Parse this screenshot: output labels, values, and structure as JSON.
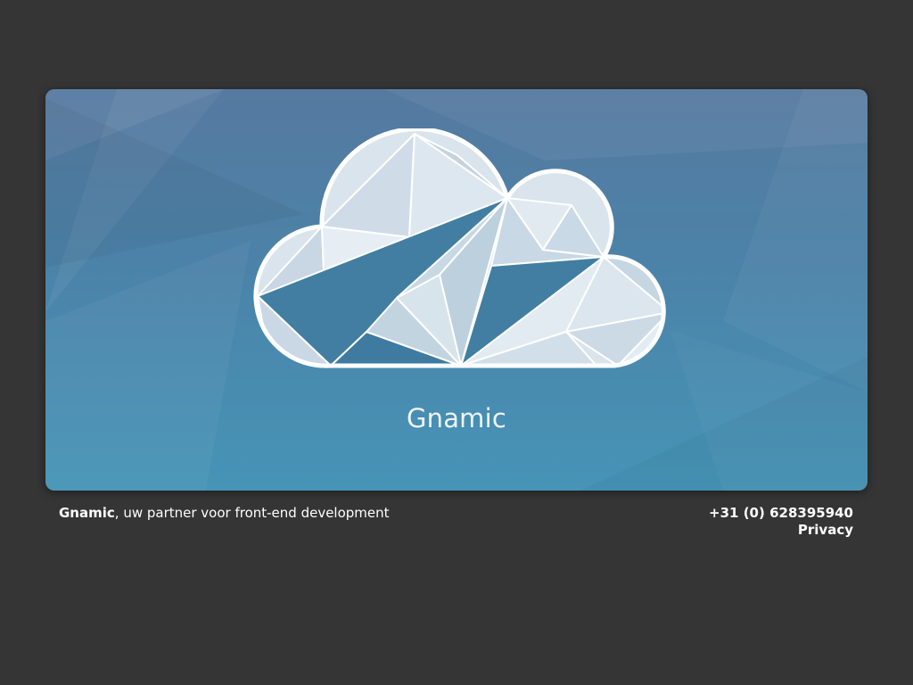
{
  "hero": {
    "brand_name": "Gnamic",
    "logo_icon": "cloud-logo-icon",
    "colors": {
      "page_background": "#353535",
      "hero_top": "#5679a0",
      "hero_bottom": "#4694b7",
      "logo_fill_dark": "#427ea2",
      "logo_fill_light": "#dfe8f0",
      "logo_outline": "#ffffff"
    }
  },
  "footer": {
    "company_name": "Gnamic",
    "tagline": ", uw partner voor front-end development",
    "phone": "+31 (0) 628395940",
    "privacy_label": "Privacy"
  }
}
